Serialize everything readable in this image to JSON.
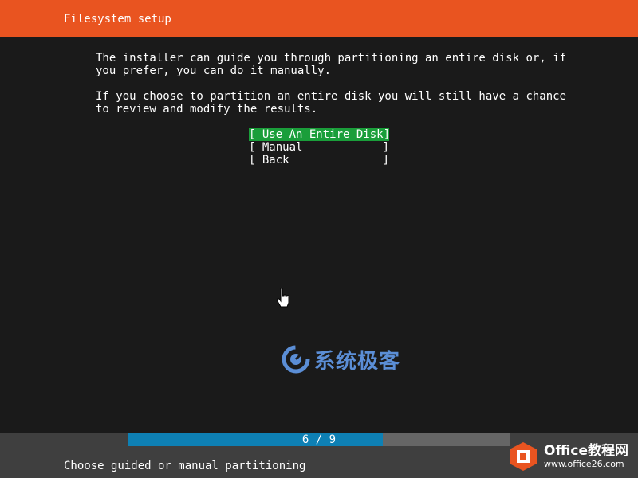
{
  "header": {
    "title": "Filesystem setup"
  },
  "intro": {
    "paragraph1": "The installer can guide you through partitioning an entire disk or, if\nyou prefer, you can do it manually.",
    "paragraph2": "If you choose to partition an entire disk you will still have a chance\nto review and modify the results."
  },
  "menu": {
    "items": [
      {
        "label": "[ Use An Entire Disk",
        "end": "]",
        "selected": true
      },
      {
        "label": "[ Manual",
        "end": "]",
        "selected": false
      },
      {
        "label": "[ Back",
        "end": "]",
        "selected": false
      }
    ]
  },
  "progress": {
    "label": "6 / 9",
    "current": 6,
    "total": 9
  },
  "status": {
    "text": "Choose guided or manual partitioning"
  },
  "watermark": {
    "text": "系统极客"
  },
  "office_logo": {
    "title": "Office教程网",
    "url": "www.office26.com"
  },
  "colors": {
    "header": "#e95420",
    "background": "#1a1a1a",
    "selected": "#1a9e3a",
    "progress_fill": "#0e80b4",
    "progress_bg": "#666666",
    "bottom_bar": "#3f3f3f"
  },
  "icons": {
    "cursor": "hand-pointer-icon",
    "watermark": "refresh-logo-icon",
    "office": "office-logo-icon"
  }
}
